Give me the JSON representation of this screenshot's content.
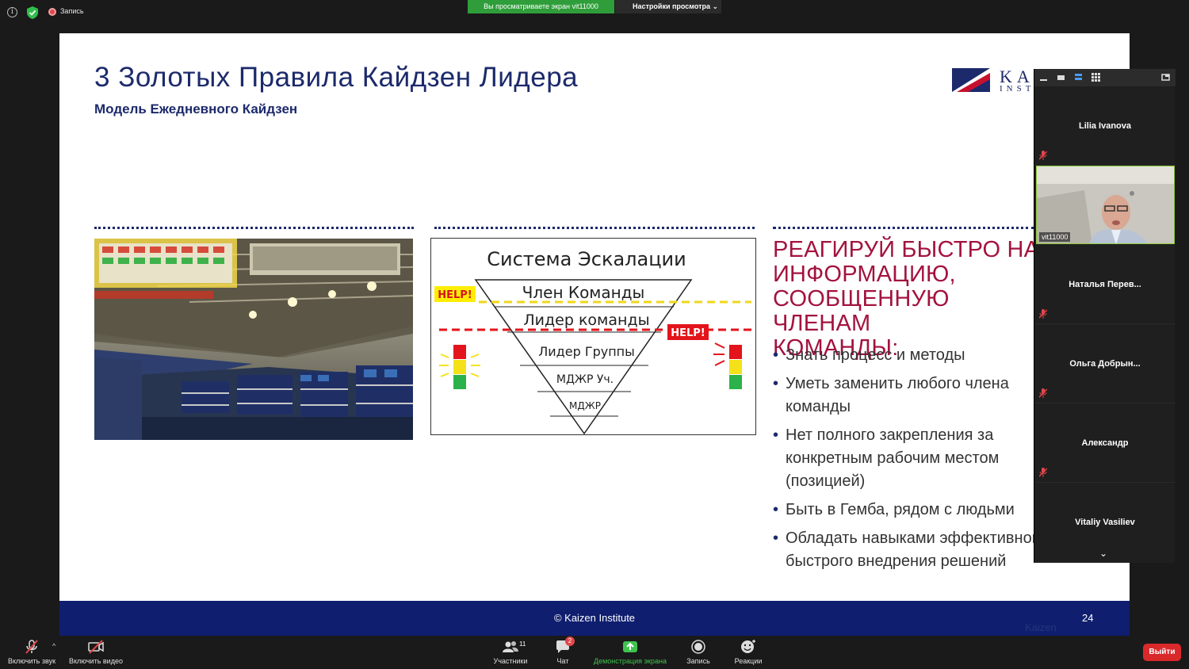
{
  "topbar": {
    "record_label": "Запись",
    "viewing_banner": "Вы просматриваете экран vit11000",
    "view_options": "Настройки просмотра"
  },
  "slide": {
    "title": "3 Золотых Правила Кайдзен Лидера",
    "subtitle": "Модель Ежедневного Кайдзен",
    "logo_word_top": "KA",
    "logo_word_bottom": "INST",
    "diagram": {
      "title": "Система Эскалации",
      "levels": [
        "Член Команды",
        "Лидер команды",
        "Лидер Группы",
        "МДЖР Уч.",
        "МДЖР"
      ],
      "help_label": "HELP!"
    },
    "headline_lines": [
      "РЕАГИРУЙ БЫСТРО НА",
      "ИНФОРМАЦИЮ,",
      "СООБЩЕННУЮ ЧЛЕНАМ",
      "КОМАНДЫ:"
    ],
    "bullets": [
      [
        "Знать процесс и методы"
      ],
      [
        "Уметь заменить любого члена",
        "команды"
      ],
      [
        "Нет полного закрепления за",
        "конкретным рабочим местом",
        "(позицией)"
      ],
      [
        "Быть в Гемба, рядом с людьми"
      ],
      [
        "Обладать навыками эффективного",
        "быстрого внедрения решений"
      ]
    ],
    "footer_text": "© Kaizen Institute",
    "page_number": "24",
    "footer_ghost": "Kaizen"
  },
  "participants": {
    "tiles": [
      {
        "name": "Lilia Ivanova",
        "muted": true
      },
      {
        "name": "vit11000",
        "video": true
      },
      {
        "name": "Наталья  Перев...",
        "muted": true
      },
      {
        "name": "Ольга  Добрын...",
        "muted": true
      },
      {
        "name": "Александр",
        "muted": true
      },
      {
        "name": "Vitaliy Vasiliev",
        "muted": false
      }
    ]
  },
  "toolbar": {
    "unmute_label": "Включить звук",
    "video_label": "Включить видео",
    "participants_label": "Участники",
    "participants_count": "11",
    "chat_label": "Чат",
    "chat_badge": "2",
    "share_label": "Демонстрация экрана",
    "record_label": "Запись",
    "reactions_label": "Реакции",
    "leave_label": "Выйти"
  },
  "colors": {
    "navy": "#1c2a6b",
    "crimson": "#a3133f",
    "zoom_green": "#2f9e3a",
    "leave_red": "#d9292b"
  }
}
